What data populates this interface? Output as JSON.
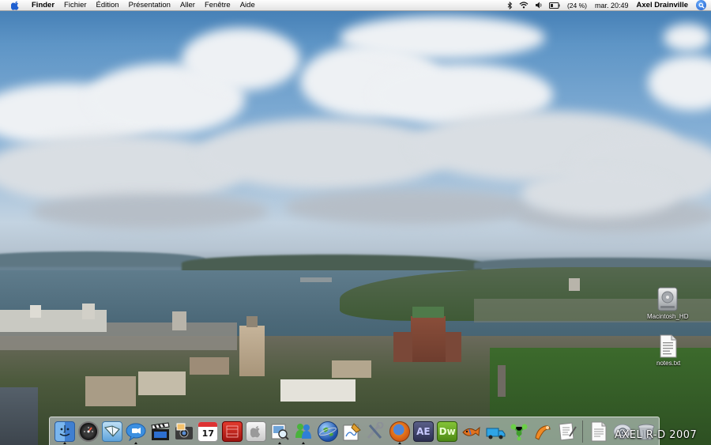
{
  "menubar": {
    "app": "Finder",
    "menus": [
      "Fichier",
      "Édition",
      "Présentation",
      "Aller",
      "Fenêtre",
      "Aide"
    ],
    "battery": "(24 %)",
    "clock": "mar. 20:49",
    "user": "Axel Drainville"
  },
  "desktop_icons": [
    {
      "label": "Macintosh_HD",
      "icon": "hard-drive-icon"
    },
    {
      "label": "notes.txt",
      "icon": "text-document-icon"
    }
  ],
  "dock": {
    "apps": [
      {
        "name": "finder",
        "icon": "finder-icon",
        "running": true
      },
      {
        "name": "dashboard",
        "icon": "dashboard-icon",
        "running": false
      },
      {
        "name": "mail",
        "icon": "mail-icon",
        "running": false
      },
      {
        "name": "ichat",
        "icon": "ichat-icon",
        "running": true
      },
      {
        "name": "final-cut",
        "icon": "clapper-icon",
        "running": false
      },
      {
        "name": "iphoto",
        "icon": "photo-icon",
        "running": false
      },
      {
        "name": "ical",
        "icon": "calendar-icon",
        "running": false,
        "text": "17"
      },
      {
        "name": "photobooth",
        "icon": "film-red-icon",
        "running": false
      },
      {
        "name": "system",
        "icon": "apple-icon",
        "running": false
      },
      {
        "name": "preview",
        "icon": "preview-icon",
        "running": true
      },
      {
        "name": "msn",
        "icon": "messenger-icon",
        "running": true
      },
      {
        "name": "google-earth",
        "icon": "globe-icon",
        "running": false
      },
      {
        "name": "pages",
        "icon": "pen-icon",
        "running": false
      },
      {
        "name": "utilities",
        "icon": "tools-icon",
        "running": false
      },
      {
        "name": "firefox",
        "icon": "firefox-icon",
        "running": true
      },
      {
        "name": "after-effects",
        "icon": "after-effects-icon",
        "running": false,
        "text": "AE"
      },
      {
        "name": "dreamweaver",
        "icon": "dreamweaver-icon",
        "running": false,
        "text": "Dw"
      },
      {
        "name": "ftp",
        "icon": "fish-icon",
        "running": false
      },
      {
        "name": "transmit",
        "icon": "truck-icon",
        "running": false
      },
      {
        "name": "synergy",
        "icon": "network-icon",
        "running": false
      },
      {
        "name": "scripting",
        "icon": "orange-tool-icon",
        "running": false
      },
      {
        "name": "textedit",
        "icon": "text-edit-icon",
        "running": false
      }
    ],
    "docs": [
      {
        "name": "document",
        "icon": "document-icon"
      },
      {
        "name": "web-shortcut",
        "icon": "web-at-icon"
      },
      {
        "name": "trash",
        "icon": "trash-icon"
      }
    ]
  },
  "watermark": "AXEL R-D 2007"
}
